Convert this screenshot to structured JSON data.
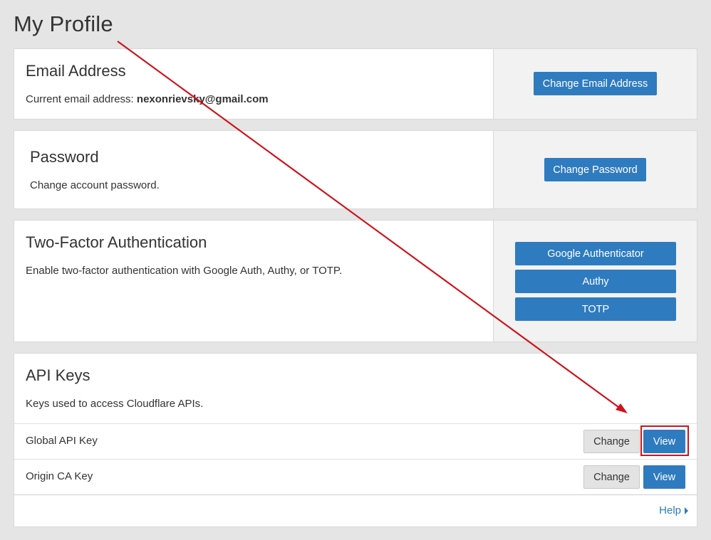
{
  "page": {
    "title": "My Profile"
  },
  "email_card": {
    "title": "Email Address",
    "desc_prefix": "Current email address: ",
    "email": "nexonrievsky@gmail.com",
    "button_label": "Change Email Address"
  },
  "password_card": {
    "title": "Password",
    "desc": "Change account password.",
    "button_label": "Change Password"
  },
  "twofa_card": {
    "title": "Two-Factor Authentication",
    "desc": "Enable two-factor authentication with Google Auth, Authy, or TOTP.",
    "buttons": [
      "Google Authenticator",
      "Authy",
      "TOTP"
    ]
  },
  "api_card": {
    "title": "API Keys",
    "desc": "Keys used to access Cloudflare APIs.",
    "rows": [
      {
        "label": "Global API Key",
        "change_label": "Change",
        "view_label": "View"
      },
      {
        "label": "Origin CA Key",
        "change_label": "Change",
        "view_label": "View"
      }
    ],
    "help_label": "Help"
  },
  "colors": {
    "primary": "#2f7bbf",
    "annotation": "#d0121b",
    "background": "#e5e5e5"
  }
}
